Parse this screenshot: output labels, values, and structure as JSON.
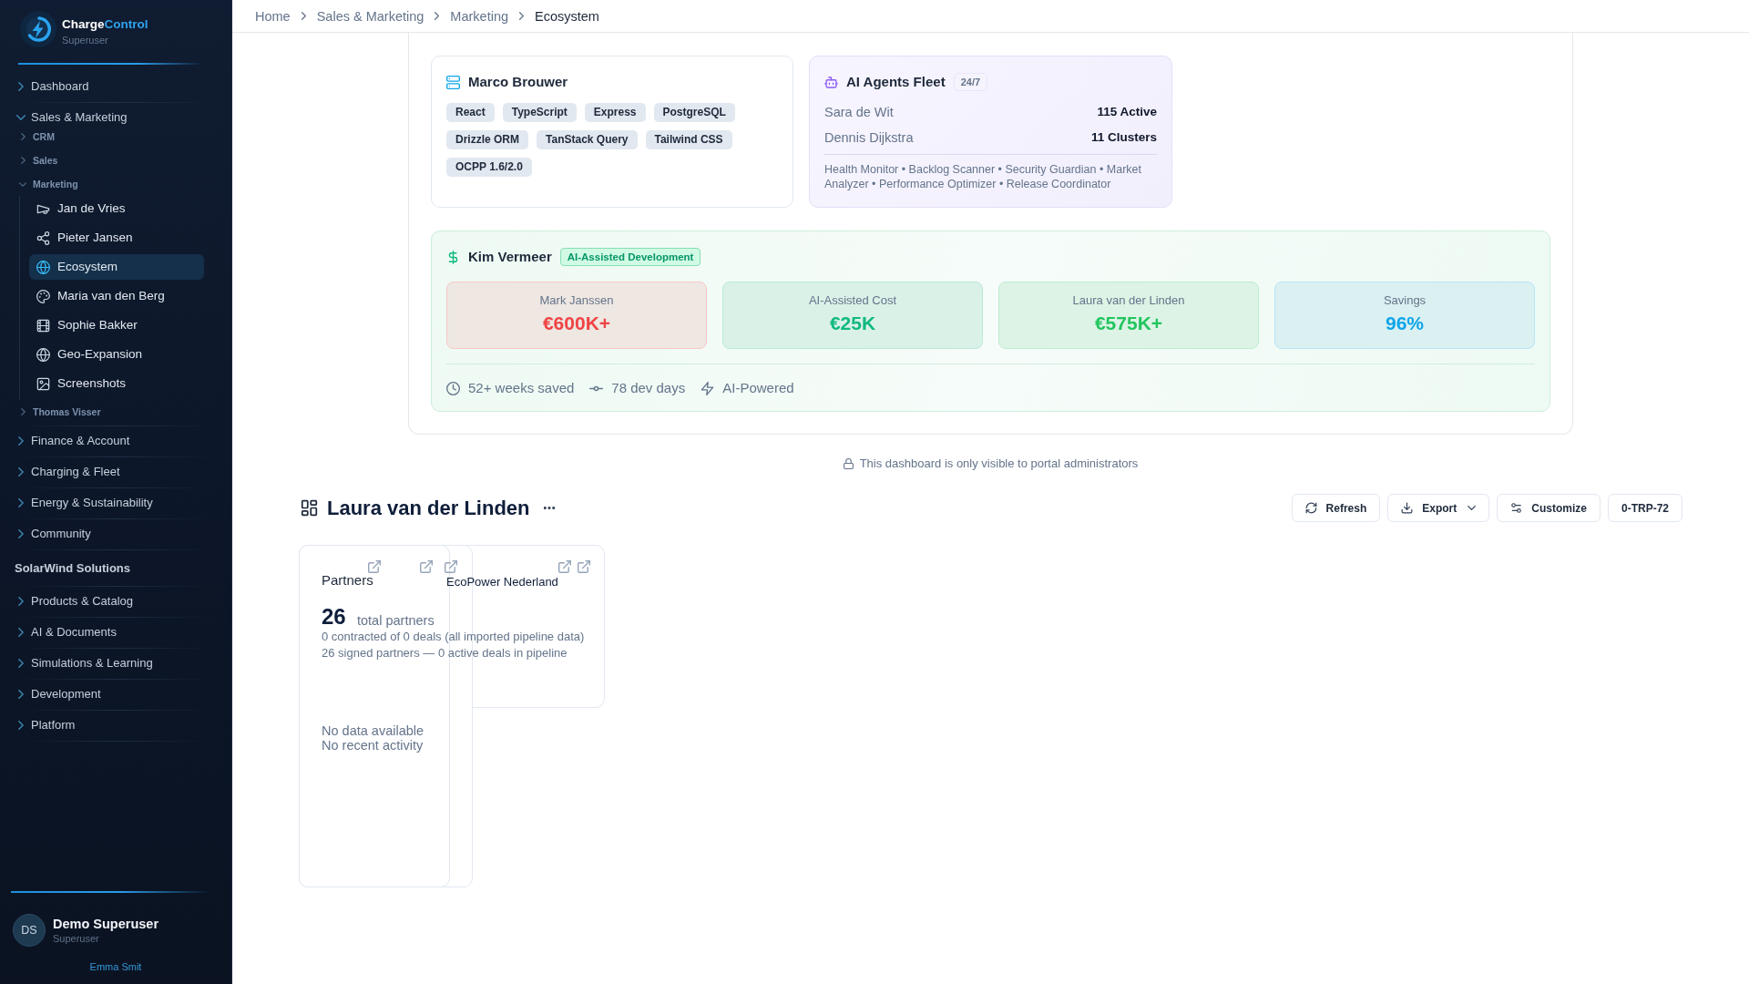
{
  "sidebar": {
    "brand": {
      "name": "Charge",
      "name_accent": "Control",
      "subtitle": "Superuser"
    },
    "items": [
      {
        "kind": "group",
        "label": "Dashboard",
        "expanded": false
      },
      {
        "kind": "group",
        "label": "Sales & Marketing",
        "expanded": true,
        "children": [
          {
            "kind": "subgroup",
            "label": "CRM",
            "expanded": false
          },
          {
            "kind": "subgroup",
            "label": "Sales",
            "expanded": false
          },
          {
            "kind": "subgroup",
            "label": "Marketing",
            "expanded": true,
            "children": [
              {
                "kind": "link",
                "label": "Jan de Vries",
                "selected": false
              },
              {
                "kind": "link",
                "label": "Pieter Jansen",
                "selected": false
              },
              {
                "kind": "link",
                "label": "Ecosystem",
                "selected": true
              },
              {
                "kind": "link",
                "label": "Maria van den Berg",
                "selected": false
              },
              {
                "kind": "link",
                "label": "Sophie Bakker",
                "selected": false
              },
              {
                "kind": "link",
                "label": "Geo-Expansion",
                "selected": false
              },
              {
                "kind": "link",
                "label": "Screenshots",
                "selected": false
              }
            ]
          },
          {
            "kind": "subgroup",
            "label": "Thomas Visser",
            "expanded": false
          }
        ]
      },
      {
        "kind": "group",
        "label": "Finance & Account",
        "expanded": false
      },
      {
        "kind": "group",
        "label": "Charging & Fleet",
        "expanded": false
      },
      {
        "kind": "group",
        "label": "Energy & Sustainability",
        "expanded": false
      },
      {
        "kind": "group",
        "label": "Community",
        "expanded": false
      },
      {
        "kind": "heading",
        "label": "SolarWind Solutions"
      },
      {
        "kind": "group",
        "label": "Products & Catalog",
        "expanded": false
      },
      {
        "kind": "group",
        "label": "AI & Documents",
        "expanded": false
      },
      {
        "kind": "group",
        "label": "Simulations & Learning",
        "expanded": false
      },
      {
        "kind": "group",
        "label": "Development",
        "expanded": false
      },
      {
        "kind": "group",
        "label": "Platform",
        "expanded": false
      }
    ],
    "user": {
      "initials": "DS",
      "name": "Demo Superuser",
      "role": "Superuser",
      "link": "Emma Smit"
    }
  },
  "breadcrumb": [
    "Home",
    "Sales & Marketing",
    "Marketing",
    "Ecosystem"
  ],
  "tech_stack_card": {
    "title": "Marco Brouwer",
    "tags": [
      "React",
      "TypeScript",
      "Express",
      "PostgreSQL",
      "Drizzle ORM",
      "TanStack Query",
      "Tailwind CSS",
      "OCPP 1.6/2.0"
    ]
  },
  "agents_card": {
    "title": "AI Agents Fleet",
    "badge": "24/7",
    "rows": [
      {
        "label": "Sara de Wit",
        "value": "115 Active"
      },
      {
        "label": "Dennis Dijkstra",
        "value": "11 Clusters"
      }
    ],
    "agents": "Health Monitor • Backlog Scanner • Security Guardian • Market Analyzer • Performance Optimizer • Release Coordinator"
  },
  "savings_panel": {
    "title": "Kim Vermeer",
    "badge": "AI-Assisted Development",
    "stats": [
      {
        "label": "Mark Janssen",
        "value": "€600K+",
        "color": "#ef4444"
      },
      {
        "label": "AI-Assisted Cost",
        "value": "€25K",
        "color": "#10b981"
      },
      {
        "label": "Laura van der Linden",
        "value": "€575K+",
        "color": "#22c55e"
      },
      {
        "label": "Savings",
        "value": "96%",
        "color": "#0ea5e9"
      }
    ],
    "highlights": [
      "52+ weeks saved",
      "78 dev days",
      "AI-Powered"
    ]
  },
  "admin_notice": "This dashboard is only visible to portal administrators",
  "dashboard": {
    "title": "Laura van der Linden",
    "buttons": [
      {
        "label": "Refresh",
        "kind": "refresh"
      },
      {
        "label": "Export",
        "kind": "export"
      },
      {
        "label": "Customize",
        "kind": "customize"
      },
      {
        "label": "0-TRP-72",
        "kind": "plain"
      }
    ],
    "widgets": [
      {
        "title": "Partners",
        "value": "26",
        "value_caption": "total partners",
        "details": [
          "0 contracted of 0 deals (all imported pipeline data)",
          "26 signed partners — 0 active deals in pipeline"
        ],
        "empty_states": [
          "No data available",
          "No recent activity"
        ]
      },
      {
        "title": "EcoPower Nederland"
      }
    ]
  }
}
